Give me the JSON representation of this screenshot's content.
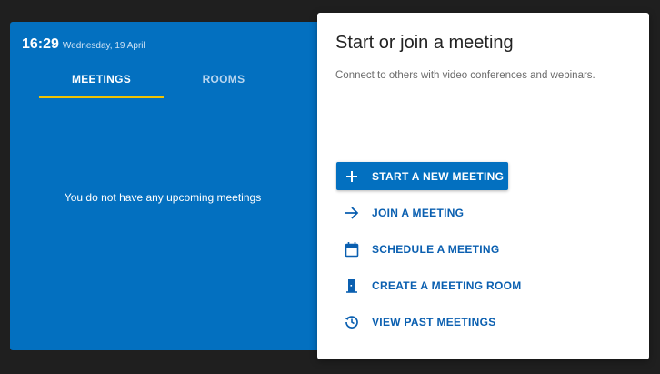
{
  "clock": {
    "time": "16:29",
    "date": "Wednesday, 19 April"
  },
  "tabs": [
    {
      "label": "MEETINGS",
      "active": true
    },
    {
      "label": "ROOMS",
      "active": false
    }
  ],
  "meetings_panel": {
    "empty_message": "You do not have any upcoming meetings"
  },
  "dialog": {
    "title": "Start or join a meeting",
    "subtitle": "Connect to others with video conferences and webinars.",
    "actions": [
      {
        "label": "START A NEW MEETING",
        "icon": "plus-icon",
        "primary": true
      },
      {
        "label": "JOIN A MEETING",
        "icon": "arrow-right-icon",
        "primary": false
      },
      {
        "label": "SCHEDULE A MEETING",
        "icon": "calendar-icon",
        "primary": false
      },
      {
        "label": "CREATE A MEETING ROOM",
        "icon": "door-icon",
        "primary": false
      },
      {
        "label": "VIEW PAST MEETINGS",
        "icon": "history-icon",
        "primary": false
      }
    ]
  },
  "colors": {
    "background": "#1f1f1f",
    "panel_blue": "#0370c0",
    "tab_indicator": "#f2c200",
    "action_text": "#0a5fb0",
    "card": "#ffffff"
  }
}
